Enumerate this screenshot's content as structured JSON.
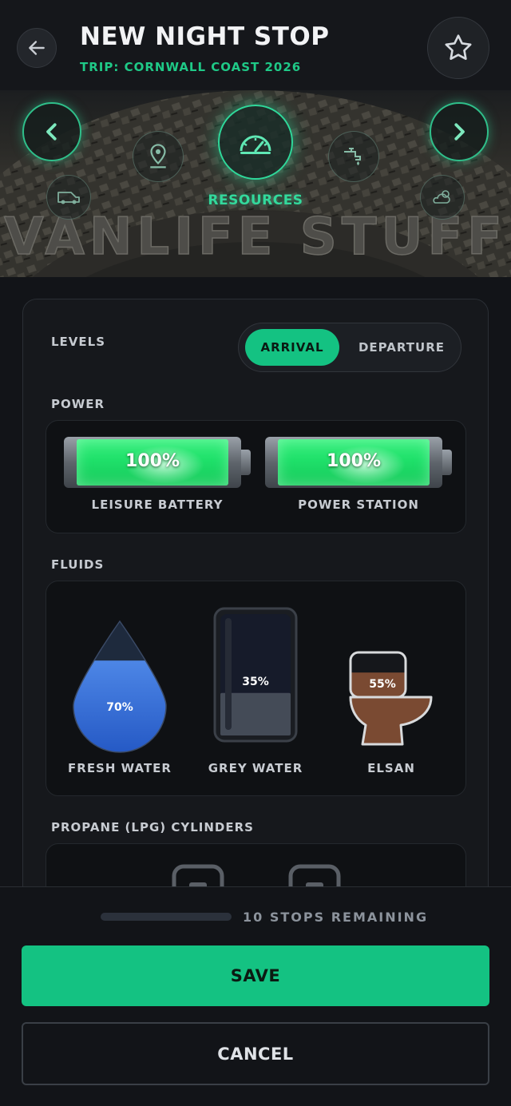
{
  "header": {
    "title": "NEW NIGHT STOP",
    "subtitle": "TRIP: CORNWALL COAST 2026"
  },
  "banner": {
    "brand_text": "VANLIFE STUFF",
    "active_step_label": "RESOURCES",
    "steps": [
      "van-icon",
      "location-pin-icon",
      "gauge-icon",
      "tap-icon",
      "weather-icon"
    ]
  },
  "levels": {
    "label": "LEVELS",
    "options": [
      "ARRIVAL",
      "DEPARTURE"
    ],
    "selected": "ARRIVAL"
  },
  "power": {
    "label": "POWER",
    "items": [
      {
        "name": "LEISURE BATTERY",
        "percent": "100%",
        "level": 1.0
      },
      {
        "name": "POWER STATION",
        "percent": "100%",
        "level": 1.0
      }
    ]
  },
  "fluids": {
    "label": "FLUIDS",
    "items": [
      {
        "name": "FRESH WATER",
        "percent": "70%",
        "level": 0.7,
        "color": "#2f6fd6"
      },
      {
        "name": "GREY WATER",
        "percent": "35%",
        "level": 0.35,
        "color": "#3d4350"
      },
      {
        "name": "ELSAN",
        "percent": "55%",
        "level": 0.55,
        "color": "#7a4a32"
      }
    ]
  },
  "propane": {
    "label": "PROPANE (LPG) CYLINDERS"
  },
  "footer": {
    "remaining_text": "10 STOPS REMAINING",
    "progress": 0.0,
    "save_label": "SAVE",
    "cancel_label": "CANCEL"
  },
  "colors": {
    "accent": "#14c282",
    "accent_glow": "#2fd89a",
    "background": "#121418"
  }
}
